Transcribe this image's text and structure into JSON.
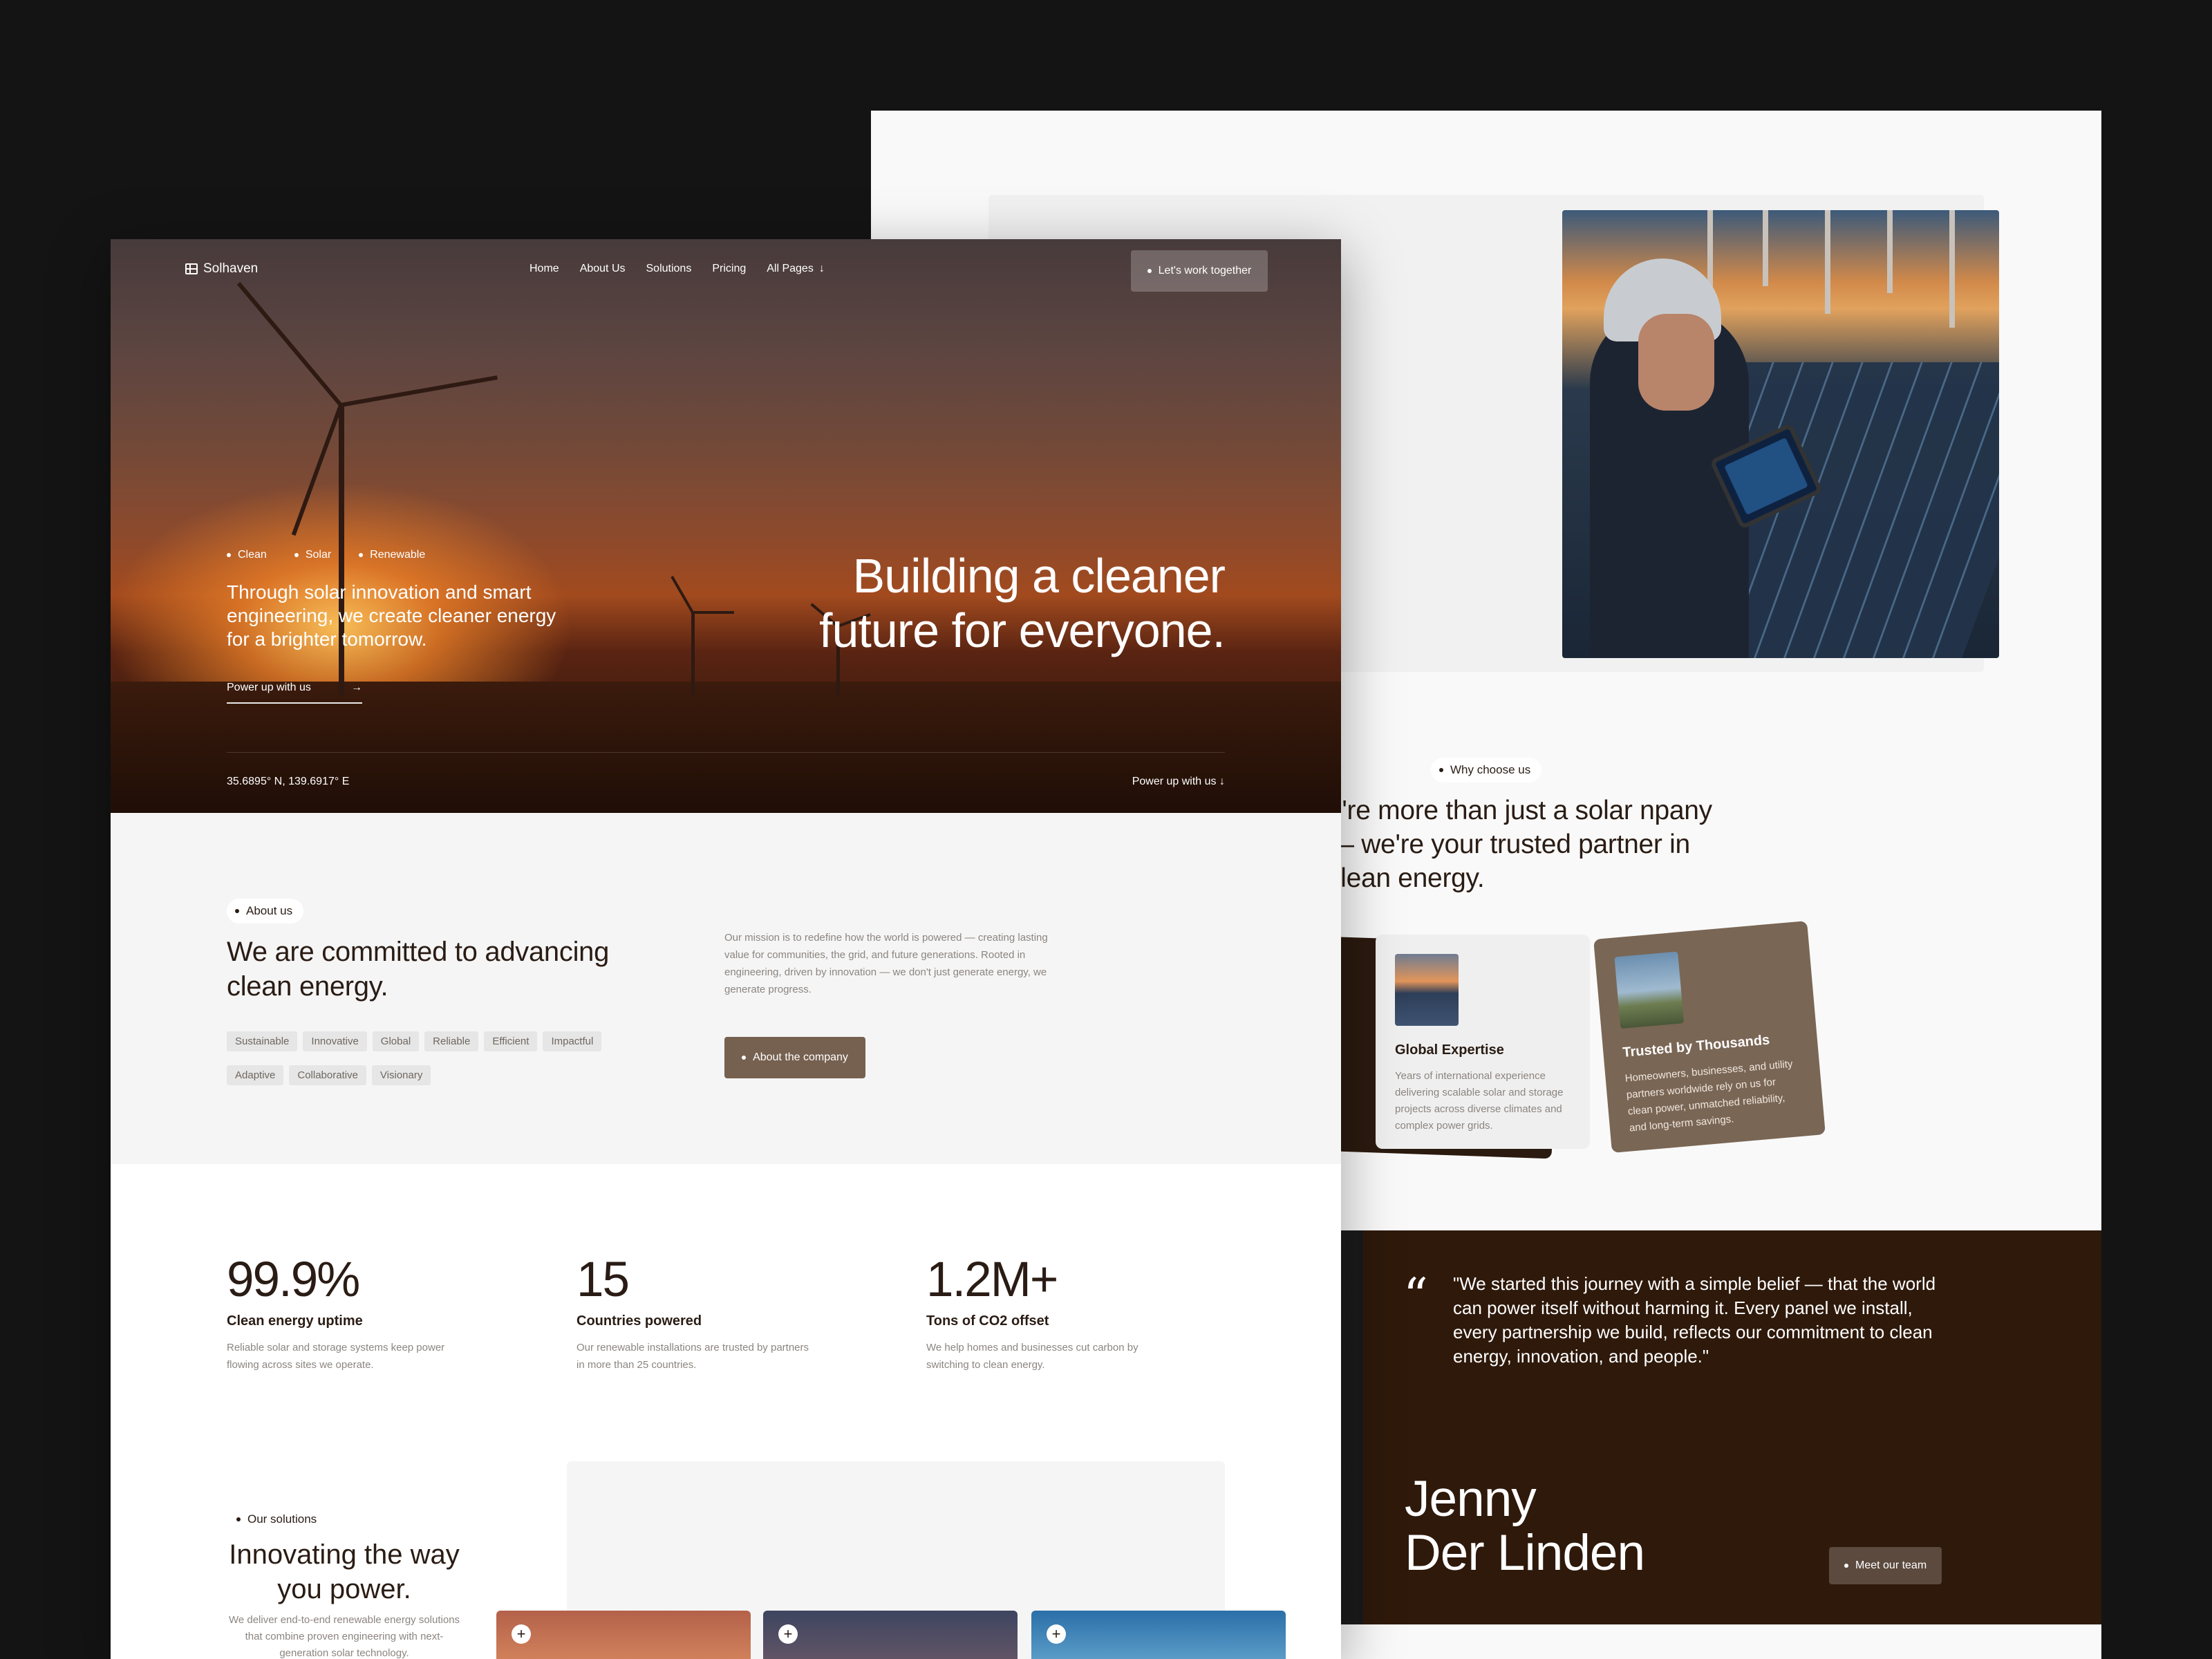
{
  "back": {
    "why": {
      "pill": "Why choose us",
      "title": "e're more than just a solar npany — we're your trusted partner in clean energy."
    },
    "cards": [
      {
        "title": "Global Expertise",
        "text": "Years of international experience delivering scalable solar and storage projects across diverse climates and complex power grids."
      },
      {
        "title": "Trusted by Thousands",
        "text": "Homeowners, businesses, and utility partners worldwide rely on us for clean power, unmatched reliability, and long-term savings."
      }
    ],
    "testimonial": {
      "quote_mark": "“",
      "quote": "\"We started this journey with a simple belief — that the world can power itself without harming it. Every panel we install, every partnership we build, reflects our commitment to clean energy, innovation, and people.\"",
      "author_first": "Jenny",
      "author_last": "Der Linden",
      "button": "Meet our team"
    }
  },
  "nav": {
    "logo": "Solhaven",
    "links": [
      "Home",
      "About Us",
      "Solutions",
      "Pricing",
      "All Pages"
    ],
    "cta": "Let's work together"
  },
  "hero": {
    "tags": [
      "Clean",
      "Solar",
      "Renewable"
    ],
    "subtitle": "Through solar innovation and smart engineering, we create cleaner energy for a brighter tomorrow.",
    "link": "Power up with us",
    "title": "Building a cleaner future for everyone.",
    "coords": "35.6895° N, 139.6917° E",
    "powerup": "Power up with us"
  },
  "about": {
    "pill": "About us",
    "title": "We are committed to advancing clean energy.",
    "tags": [
      "Sustainable",
      "Innovative",
      "Global",
      "Reliable",
      "Efficient",
      "Impactful",
      "Adaptive",
      "Collaborative",
      "Visionary"
    ],
    "text": "Our mission is to redefine how the world is powered — creating lasting value for communities, the grid, and future generations. Rooted in engineering, driven by innovation — we don't just generate energy, we generate progress.",
    "button": "About the company"
  },
  "stats": [
    {
      "value": "99.9%",
      "label": "Clean energy uptime",
      "desc": "Reliable solar and storage systems keep power flowing across sites we operate."
    },
    {
      "value": "15",
      "label": "Countries powered",
      "desc": "Our renewable installations are trusted by partners in more than 25 countries."
    },
    {
      "value": "1.2M+",
      "label": "Tons of CO2 offset",
      "desc": "We help homes and businesses cut carbon by switching to clean energy."
    }
  ],
  "solutions": {
    "pill": "Our solutions",
    "title": "Innovating the way you power.",
    "text": "We deliver end-to-end renewable energy solutions that combine proven engineering with next-generation solar technology."
  },
  "colors": {
    "dark_brown": "#2e190b",
    "accent_brown": "#76604f",
    "ink": "#2a1c14",
    "muted": "#8c8580"
  }
}
